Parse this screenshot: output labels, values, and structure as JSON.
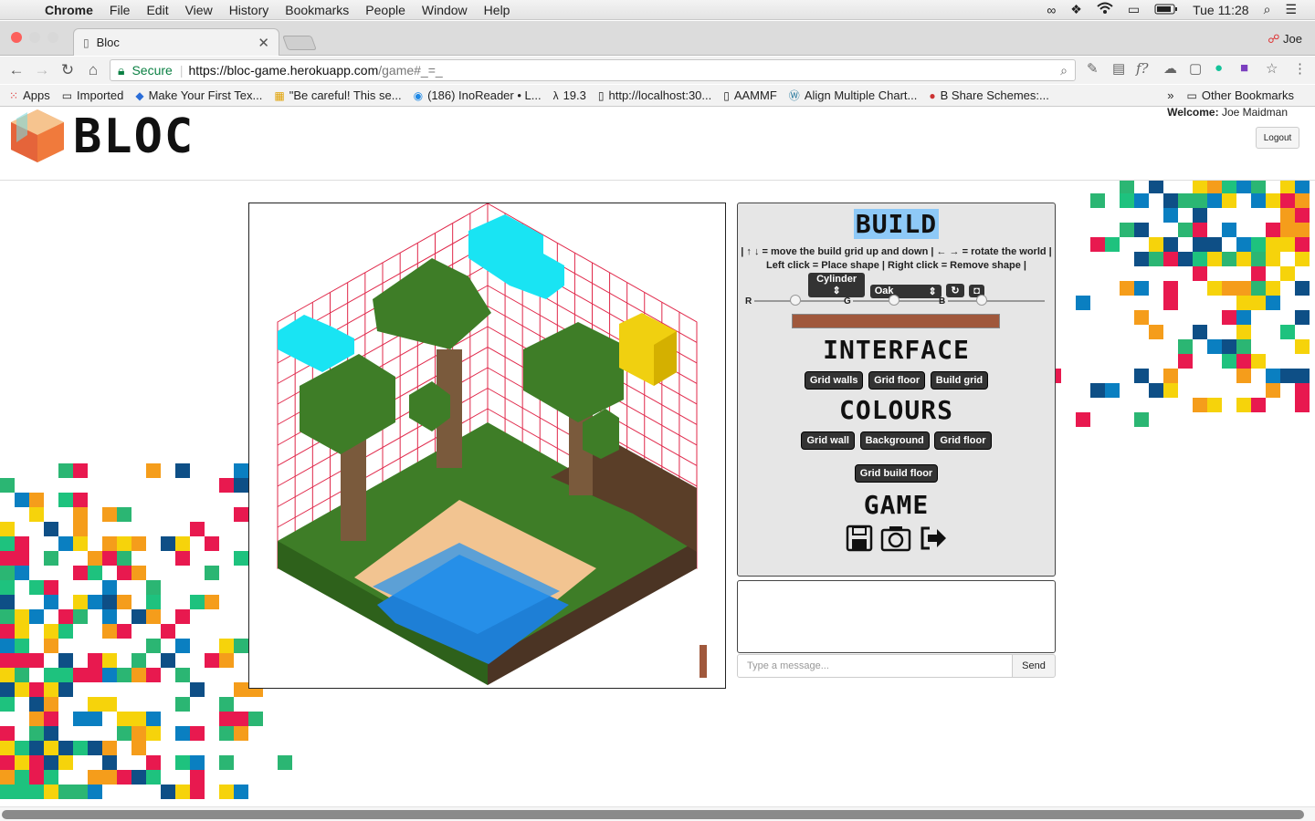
{
  "menubar": {
    "app": "Chrome",
    "items": [
      "File",
      "Edit",
      "View",
      "History",
      "Bookmarks",
      "People",
      "Window",
      "Help"
    ],
    "clock": "Tue 11:28"
  },
  "browser": {
    "tab_title": "Bloc",
    "profile": "Joe",
    "secure_label": "Secure",
    "url_host": "https://bloc-game.herokuapp.com",
    "url_path": "/game#_=_"
  },
  "bookmarks": {
    "items": [
      {
        "label": "Apps",
        "icon": "apps-grid-icon"
      },
      {
        "label": "Imported",
        "icon": "folder-icon"
      },
      {
        "label": "Make Your First Tex...",
        "icon": "diamond-icon"
      },
      {
        "label": "\"Be careful! This se...",
        "icon": "windows-icon"
      },
      {
        "label": "(186) InoReader • L...",
        "icon": "rss-icon"
      },
      {
        "label": "19.3",
        "icon": "lambda-icon"
      },
      {
        "label": "http://localhost:30...",
        "icon": "page-icon"
      },
      {
        "label": "AAMMF",
        "icon": "page-icon"
      },
      {
        "label": "Align Multiple Chart...",
        "icon": "wordpress-icon"
      },
      {
        "label": "B Share Schemes:...",
        "icon": "shield-icon"
      }
    ],
    "overflow": "»",
    "other": "Other Bookmarks"
  },
  "header": {
    "logo": "BLOC",
    "welcome_label": "Welcome:",
    "welcome_user": "Joe Maidman",
    "logout": "Logout"
  },
  "panel": {
    "build_title": "BUILD",
    "help_line1": "| ↑ ↓ = move the build grid up and down | ← → = rotate the world |",
    "help_line2": "Left click = Place shape | Right click = Remove shape |",
    "shape_select": "Cylinder",
    "material_select": "Oak",
    "rgb_labels": [
      "R",
      "G",
      "B"
    ],
    "rgb_levels": [
      0.45,
      0.45,
      0.35
    ],
    "swatch_color": "#a0583c",
    "interface_title": "INTERFACE",
    "interface_buttons": [
      "Grid walls",
      "Grid floor",
      "Build grid"
    ],
    "colours_title": "COLOURS",
    "colour_buttons": [
      "Grid wall",
      "Background",
      "Grid floor"
    ],
    "colour_button_extra": "Grid build floor",
    "game_title": "GAME"
  },
  "chat": {
    "placeholder": "Type a message...",
    "send": "Send"
  },
  "colors": {
    "grid": "#e0284a",
    "grass": "#3e7d27",
    "trunk": "#7a5a3c",
    "water": "#1e7fd6",
    "sand": "#f2c491",
    "cloud": "#19e4f3",
    "sun": "#f0d010"
  }
}
